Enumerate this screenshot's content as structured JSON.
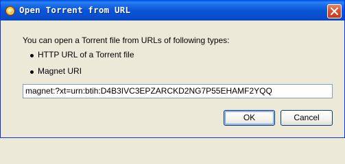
{
  "window": {
    "title": "Open Torrent from URL"
  },
  "dialog": {
    "intro": "You can open a Torrent file from URLs of following types:",
    "types": [
      "HTTP URL of a Torrent file",
      "Magnet URI"
    ],
    "url_value": "magnet:?xt=urn:btih:D4B3IVC3EPZARCKD2NG7P55EHAMF2YQQ"
  },
  "buttons": {
    "ok_label": "OK",
    "cancel_label": "Cancel"
  },
  "colors": {
    "titlebar": "#0955d6",
    "close": "#d9522f",
    "face": "#ece9d8"
  }
}
